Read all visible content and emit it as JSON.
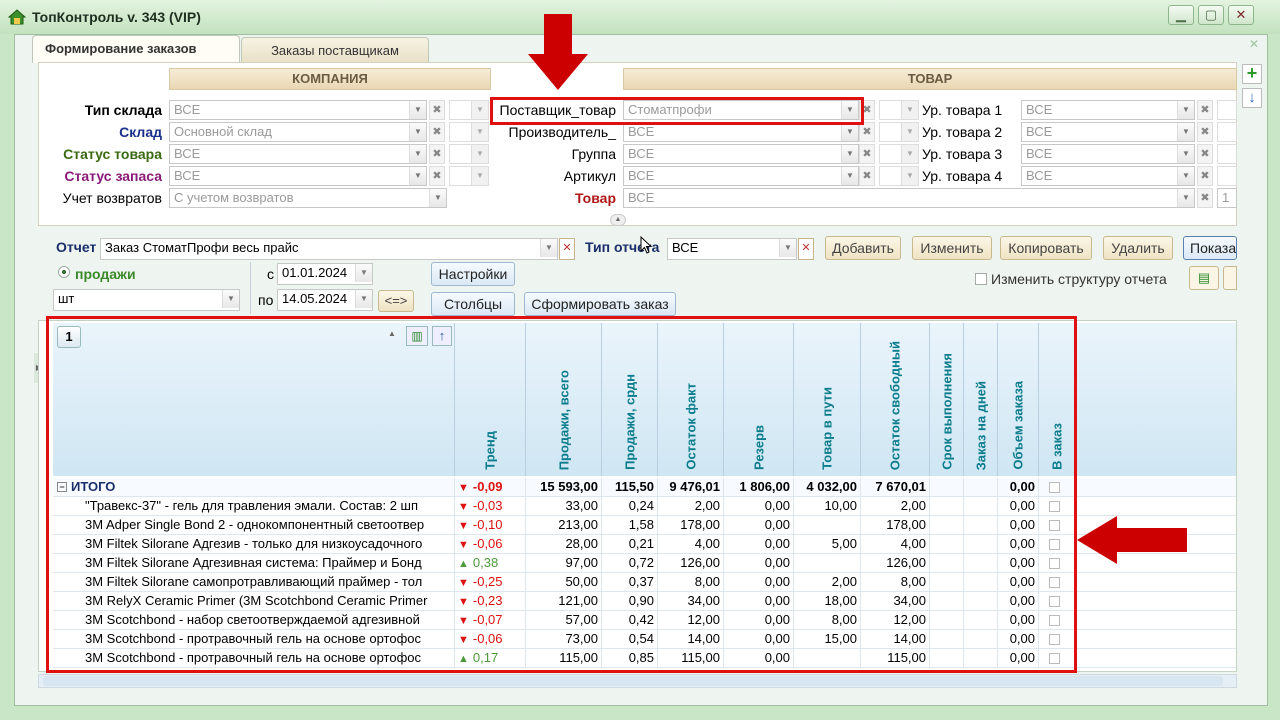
{
  "window": {
    "title": "ТопКонтроль v. 343 (VIP)"
  },
  "tabs": [
    {
      "label": "Формирование заказов"
    },
    {
      "label": "Заказы поставщикам"
    }
  ],
  "sections": {
    "company": "КОМПАНИЯ",
    "product": "ТОВАР"
  },
  "company_filters": [
    {
      "label": "Тип склада",
      "value": "ВСЕ",
      "color": "#000000"
    },
    {
      "label": "Склад",
      "value": "Основной склад",
      "color": "#1a2f8a"
    },
    {
      "label": "Статус товара",
      "value": "ВСЕ",
      "color": "#3a6a12"
    },
    {
      "label": "Статус запаса",
      "value": "ВСЕ",
      "color": "#8a1a7a"
    },
    {
      "label": "Учет возвратов",
      "value": "С учетом возвратов",
      "color": "#000000"
    }
  ],
  "product_filters_left": [
    {
      "label": "Поставщик_товар",
      "value": "Стоматпрофи"
    },
    {
      "label": "Производитель_",
      "value": "ВСЕ"
    },
    {
      "label": "Группа",
      "value": "ВСЕ"
    },
    {
      "label": "Артикул",
      "value": "ВСЕ"
    },
    {
      "label": "Товар",
      "value": "ВСЕ"
    }
  ],
  "product_filters_right": [
    {
      "label": "Ур. товара 1",
      "value": "ВСЕ"
    },
    {
      "label": "Ур. товара 2",
      "value": "ВСЕ"
    },
    {
      "label": "Ур. товара 3",
      "value": "ВСЕ"
    },
    {
      "label": "Ур. товара 4",
      "value": "ВСЕ"
    }
  ],
  "product_extra": "1",
  "report": {
    "label": "Отчет",
    "value": "Заказ СтоматПрофи весь прайс",
    "type_label": "Тип отчета",
    "type_value": "ВСЕ",
    "buttons": [
      "Добавить",
      "Изменить",
      "Копировать",
      "Удалить",
      "Показать"
    ],
    "sales_label": "продажи",
    "unit": "шт",
    "from_label": "с",
    "from_date": "01.01.2024",
    "to_label": "по",
    "to_date": "14.05.2024",
    "swap_label": "<=>",
    "settings_button": "Настройки",
    "columns_button": "Столбцы",
    "make_order_button": "Сформировать заказ",
    "change_structure": "Изменить структуру отчета"
  },
  "grid": {
    "level_badge": "1",
    "columns": [
      "Тренд",
      "Продажи, всего",
      "Продажи, срдн",
      "Остаток факт",
      "Резерв",
      "Товар в пути",
      "Остаток свободный",
      "Срок выполнения",
      "Заказ на дней",
      "Объем заказа",
      "В заказ"
    ],
    "total": {
      "name": "ИТОГО",
      "trend": "-0,09",
      "trend_dir": "down",
      "sales": "15 593,00",
      "avg": "115,50",
      "stock": "9 476,01",
      "reserve": "1 806,00",
      "transit": "4 032,00",
      "free": "7 670,01",
      "term": "",
      "days": "",
      "volume": "0,00"
    },
    "rows": [
      {
        "name": "\"Травекс-37\" - гель для травления эмали. Состав: 2 шп",
        "trend": "-0,03",
        "trend_dir": "down",
        "sales": "33,00",
        "avg": "0,24",
        "stock": "2,00",
        "reserve": "0,00",
        "transit": "10,00",
        "free": "2,00",
        "volume": "0,00"
      },
      {
        "name": "3M Adper Single Bond 2 - однокомпонентный светоотвер",
        "trend": "-0,10",
        "trend_dir": "down",
        "sales": "213,00",
        "avg": "1,58",
        "stock": "178,00",
        "reserve": "0,00",
        "transit": "",
        "free": "178,00",
        "volume": "0,00"
      },
      {
        "name": "3M Filtek Silorane Адгезив - только для низкоусадочного",
        "trend": "-0,06",
        "trend_dir": "down",
        "sales": "28,00",
        "avg": "0,21",
        "stock": "4,00",
        "reserve": "0,00",
        "transit": "5,00",
        "free": "4,00",
        "volume": "0,00"
      },
      {
        "name": "3M Filtek Silorane Адгезивная система: Праймер и Бонд",
        "trend": "0,38",
        "trend_dir": "up",
        "sales": "97,00",
        "avg": "0,72",
        "stock": "126,00",
        "reserve": "0,00",
        "transit": "",
        "free": "126,00",
        "volume": "0,00"
      },
      {
        "name": "3M Filtek Silorane самопротравливающий праймер - тол",
        "trend": "-0,25",
        "trend_dir": "down",
        "sales": "50,00",
        "avg": "0,37",
        "stock": "8,00",
        "reserve": "0,00",
        "transit": "2,00",
        "free": "8,00",
        "volume": "0,00"
      },
      {
        "name": "3M RelyX Ceramic Primer (3M Scotchbond Ceramic Primer",
        "trend": "-0,23",
        "trend_dir": "down",
        "sales": "121,00",
        "avg": "0,90",
        "stock": "34,00",
        "reserve": "0,00",
        "transit": "18,00",
        "free": "34,00",
        "volume": "0,00"
      },
      {
        "name": "3M Scotchbond - набор светоотверждаемой адгезивной",
        "trend": "-0,07",
        "trend_dir": "down",
        "sales": "57,00",
        "avg": "0,42",
        "stock": "12,00",
        "reserve": "0,00",
        "transit": "8,00",
        "free": "12,00",
        "volume": "0,00"
      },
      {
        "name": "3M Scotchbond - протравочный гель на основе ортофос",
        "trend": "-0,06",
        "trend_dir": "down",
        "sales": "73,00",
        "avg": "0,54",
        "stock": "14,00",
        "reserve": "0,00",
        "transit": "15,00",
        "free": "14,00",
        "volume": "0,00"
      },
      {
        "name": "3M Scotchbond - протравочный гель на основе ортофос",
        "trend": "0,17",
        "trend_dir": "up",
        "sales": "115,00",
        "avg": "0,85",
        "stock": "115,00",
        "reserve": "0,00",
        "transit": "",
        "free": "115,00",
        "volume": "0,00"
      }
    ]
  },
  "colors": {
    "accent_red": "#e01010",
    "trend_down": "#dd1111",
    "trend_up": "#4a9a3a",
    "header_text": "#0a7c8c"
  }
}
